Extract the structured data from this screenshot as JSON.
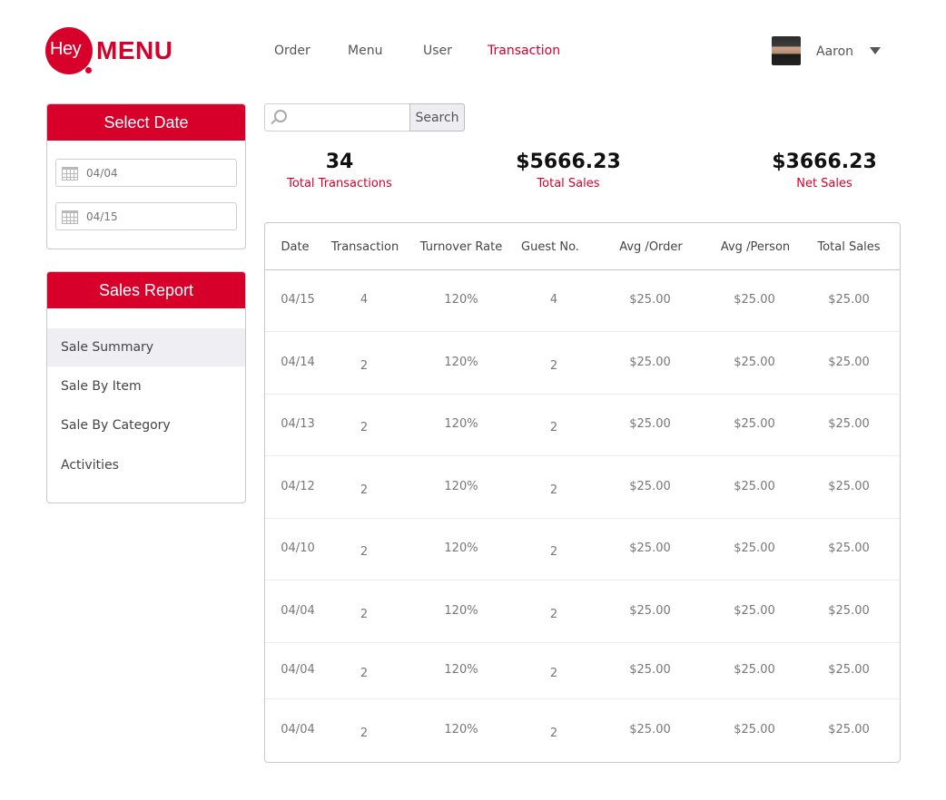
{
  "brand": {
    "hey": "Hey",
    "menu": "MENU",
    "color": "#d6002a"
  },
  "nav": {
    "items": [
      {
        "label": "Order",
        "active": false
      },
      {
        "label": "Menu",
        "active": false
      },
      {
        "label": "User",
        "active": false
      },
      {
        "label": "Transaction",
        "active": true
      }
    ]
  },
  "user": {
    "name": "Aaron"
  },
  "date_panel": {
    "title": "Select Date",
    "start": "04/04",
    "end": "04/15"
  },
  "report_panel": {
    "title": "Sales Report",
    "items": [
      {
        "label": "Sale Summary",
        "active": true
      },
      {
        "label": "Sale By Item",
        "active": false
      },
      {
        "label": "Sale By Category",
        "active": false
      },
      {
        "label": "Activities",
        "active": false
      }
    ]
  },
  "search": {
    "value": "",
    "placeholder": "",
    "button": "Search"
  },
  "stats": [
    {
      "value": "34",
      "label": "Total Transactions"
    },
    {
      "value": "$5666.23",
      "label": "Total Sales"
    },
    {
      "value": "$3666.23",
      "label": "Net Sales"
    }
  ],
  "table": {
    "headers": [
      "Date",
      "Transaction",
      "Turnover Rate",
      "Guest No.",
      "Avg /Order",
      "Avg /Person",
      "Total Sales"
    ],
    "rows": [
      [
        "04/15",
        "4",
        "120%",
        "4",
        "$25.00",
        "$25.00",
        "$25.00"
      ],
      [
        "04/14",
        "2",
        "120%",
        "2",
        "$25.00",
        "$25.00",
        "$25.00"
      ],
      [
        "04/13",
        "2",
        "120%",
        "2",
        "$25.00",
        "$25.00",
        "$25.00"
      ],
      [
        "04/12",
        "2",
        "120%",
        "2",
        "$25.00",
        "$25.00",
        "$25.00"
      ],
      [
        "04/10",
        "2",
        "120%",
        "2",
        "$25.00",
        "$25.00",
        "$25.00"
      ],
      [
        "04/04",
        "2",
        "120%",
        "2",
        "$25.00",
        "$25.00",
        "$25.00"
      ],
      [
        "04/04",
        "2",
        "120%",
        "2",
        "$25.00",
        "$25.00",
        "$25.00"
      ],
      [
        "04/04",
        "2",
        "120%",
        "2",
        "$25.00",
        "$25.00",
        "$25.00"
      ]
    ]
  }
}
